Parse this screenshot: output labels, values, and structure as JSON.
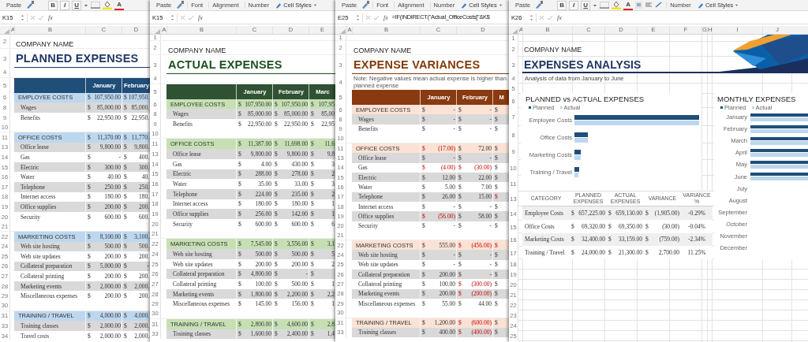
{
  "sheets": [
    {
      "kind": "table",
      "ribbon": [
        {
          "kind": "paste",
          "label": "Paste"
        },
        {
          "kind": "format",
          "labels": [
            "B",
            "I",
            "U"
          ],
          "font_color": "A"
        }
      ],
      "name_box": "K15",
      "fx": "fx",
      "columns": [
        "A",
        "B",
        "C",
        "D"
      ],
      "rows": [
        {
          "n": "2",
          "kind": "company",
          "text": "COMPANY NAME"
        },
        {
          "n": "3",
          "kind": "title",
          "text": "PLANNED EXPENSES"
        },
        {
          "n": "4",
          "kind": "blank"
        },
        {
          "n": "5",
          "kind": "months",
          "months": [
            "January",
            "February"
          ]
        },
        {
          "n": "6",
          "kind": "section",
          "label": "EMPLOYEE COSTS",
          "cells": [
            [
              "$",
              "107,950.00"
            ],
            [
              "$",
              "107,950."
            ]
          ]
        },
        {
          "n": "8",
          "kind": "item",
          "shaded": true,
          "label": "Wages",
          "cells": [
            [
              "$",
              "85,000.00"
            ],
            [
              "$",
              "85,000."
            ]
          ]
        },
        {
          "n": "9",
          "kind": "item",
          "shaded": false,
          "label": "Benefits",
          "cells": [
            [
              "$",
              "22,950.00"
            ],
            [
              "$",
              "22,950."
            ]
          ]
        },
        {
          "n": "10",
          "kind": "blank"
        },
        {
          "n": "11",
          "kind": "section",
          "label": "OFFICE COSTS",
          "cells": [
            [
              "$",
              "11,370.00"
            ],
            [
              "$",
              "11,770."
            ]
          ]
        },
        {
          "n": "13",
          "kind": "item",
          "shaded": true,
          "label": "Office lease",
          "cells": [
            [
              "$",
              "9,800.00"
            ],
            [
              "$",
              "9,800."
            ]
          ]
        },
        {
          "n": "14",
          "kind": "item",
          "shaded": false,
          "label": "Gas",
          "cells": [
            [
              "$",
              "-"
            ],
            [
              "$",
              "400."
            ]
          ]
        },
        {
          "n": "15",
          "kind": "item",
          "shaded": true,
          "label": "Electric",
          "cells": [
            [
              "$",
              "300.00"
            ],
            [
              "$",
              "300."
            ]
          ]
        },
        {
          "n": "16",
          "kind": "item",
          "shaded": false,
          "label": "Water",
          "cells": [
            [
              "$",
              "40.00"
            ],
            [
              "$",
              "40."
            ]
          ]
        },
        {
          "n": "17",
          "kind": "item",
          "shaded": true,
          "label": "Telephone",
          "cells": [
            [
              "$",
              "250.00"
            ],
            [
              "$",
              "250."
            ]
          ]
        },
        {
          "n": "18",
          "kind": "item",
          "shaded": false,
          "label": "Internet access",
          "cells": [
            [
              "$",
              "180.00"
            ],
            [
              "$",
              "180."
            ]
          ]
        },
        {
          "n": "19",
          "kind": "item",
          "shaded": true,
          "label": "Office supplies",
          "cells": [
            [
              "$",
              "200.00"
            ],
            [
              "$",
              "200."
            ]
          ]
        },
        {
          "n": "20",
          "kind": "item",
          "shaded": false,
          "label": "Security",
          "cells": [
            [
              "$",
              "600.00"
            ],
            [
              "$",
              "600."
            ]
          ]
        },
        {
          "n": "21",
          "kind": "blank"
        },
        {
          "n": "22",
          "kind": "section",
          "label": "MARKETING COSTS",
          "cells": [
            [
              "$",
              "8,100.00"
            ],
            [
              "$",
              "3,100."
            ]
          ]
        },
        {
          "n": "24",
          "kind": "item",
          "shaded": true,
          "label": "Web site hosting",
          "cells": [
            [
              "$",
              "500.00"
            ],
            [
              "$",
              "500."
            ]
          ]
        },
        {
          "n": "25",
          "kind": "item",
          "shaded": false,
          "label": "Web site updates",
          "cells": [
            [
              "$",
              "200.00"
            ],
            [
              "$",
              "200."
            ]
          ]
        },
        {
          "n": "26",
          "kind": "item",
          "shaded": true,
          "label": "Collateral preparation",
          "cells": [
            [
              "$",
              "5,000.00"
            ],
            [
              "$",
              "-"
            ]
          ]
        },
        {
          "n": "27",
          "kind": "item",
          "shaded": false,
          "label": "Collateral printing",
          "cells": [
            [
              "$",
              "200.00"
            ],
            [
              "$",
              "200."
            ]
          ]
        },
        {
          "n": "28",
          "kind": "item",
          "shaded": true,
          "label": "Marketing events",
          "cells": [
            [
              "$",
              "2,000.00"
            ],
            [
              "$",
              "2,000."
            ]
          ]
        },
        {
          "n": "29",
          "kind": "item",
          "shaded": false,
          "label": "Miscellaneous expenses",
          "cells": [
            [
              "$",
              "200.00"
            ],
            [
              "$",
              "200."
            ]
          ]
        },
        {
          "n": "30",
          "kind": "blank"
        },
        {
          "n": "31",
          "kind": "section",
          "label": "TRAINING / TRAVEL",
          "cells": [
            [
              "$",
              "4,000.00"
            ],
            [
              "$",
              "4,000."
            ]
          ]
        },
        {
          "n": "33",
          "kind": "item",
          "shaded": true,
          "label": "Training classes",
          "cells": [
            [
              "$",
              "2,000.00"
            ],
            [
              "$",
              "2,000."
            ]
          ]
        },
        {
          "n": "34",
          "kind": "item",
          "shaded": false,
          "label": "Travel costs",
          "cells": [
            [
              "$",
              "2,000.00"
            ],
            [
              "$",
              "2,000."
            ]
          ]
        }
      ]
    },
    {
      "kind": "table",
      "ribbon": [
        {
          "kind": "paste",
          "label": "Paste"
        },
        {
          "kind": "group",
          "label": "Font"
        },
        {
          "kind": "group",
          "label": "Alignment"
        },
        {
          "kind": "group",
          "label": "Number"
        },
        {
          "kind": "styles",
          "label": "Cell Styles"
        }
      ],
      "name_box": "K15",
      "fx": "fx",
      "columns": [
        "A",
        "B",
        "C",
        "D",
        "E"
      ],
      "rows": [
        {
          "n": "1",
          "kind": "blank"
        },
        {
          "n": "2",
          "kind": "company",
          "text": "COMPANY NAME"
        },
        {
          "n": "3",
          "kind": "title",
          "text": "ACTUAL EXPENSES"
        },
        {
          "n": "4",
          "kind": "blank"
        },
        {
          "n": "5",
          "kind": "months",
          "months": [
            "January",
            "February",
            "Marc"
          ]
        },
        {
          "n": "6",
          "kind": "section",
          "label": "EMPLOYEE COSTS",
          "cells": [
            [
              "$",
              "107,950.00"
            ],
            [
              "$",
              "107,950.00"
            ],
            [
              "$",
              "107,95"
            ]
          ]
        },
        {
          "n": "8",
          "kind": "item",
          "shaded": true,
          "label": "Wages",
          "cells": [
            [
              "$",
              "85,000.00"
            ],
            [
              "$",
              "85,000.00"
            ],
            [
              "$",
              "85,00"
            ]
          ]
        },
        {
          "n": "9",
          "kind": "item",
          "shaded": false,
          "label": "Benefits",
          "cells": [
            [
              "$",
              "22,950.00"
            ],
            [
              "$",
              "22,950.00"
            ],
            [
              "$",
              "22,95"
            ]
          ]
        },
        {
          "n": "10",
          "kind": "blank"
        },
        {
          "n": "11",
          "kind": "section",
          "label": "OFFICE COSTS",
          "cells": [
            [
              "$",
              "11,387.00"
            ],
            [
              "$",
              "11,698.00"
            ],
            [
              "$",
              "11,6"
            ]
          ]
        },
        {
          "n": "13",
          "kind": "item",
          "shaded": true,
          "label": "Office lease",
          "cells": [
            [
              "$",
              "9,800.00"
            ],
            [
              "$",
              "9,800.00"
            ],
            [
              "$",
              "9,8"
            ]
          ]
        },
        {
          "n": "14",
          "kind": "item",
          "shaded": false,
          "label": "Gas",
          "cells": [
            [
              "$",
              "4.00"
            ],
            [
              "$",
              "430.00"
            ],
            [
              "$",
              "3"
            ]
          ]
        },
        {
          "n": "15",
          "kind": "item",
          "shaded": true,
          "label": "Electric",
          "cells": [
            [
              "$",
              "288.00"
            ],
            [
              "$",
              "278.00"
            ],
            [
              "$",
              "2"
            ]
          ]
        },
        {
          "n": "16",
          "kind": "item",
          "shaded": false,
          "label": "Water",
          "cells": [
            [
              "$",
              "35.00"
            ],
            [
              "$",
              "33.00"
            ],
            [
              "$",
              "3"
            ]
          ]
        },
        {
          "n": "17",
          "kind": "item",
          "shaded": true,
          "label": "Telephone",
          "cells": [
            [
              "$",
              "224.00"
            ],
            [
              "$",
              "235.00"
            ],
            [
              "$",
              "2"
            ]
          ]
        },
        {
          "n": "18",
          "kind": "item",
          "shaded": false,
          "label": "Internet access",
          "cells": [
            [
              "$",
              "180.00"
            ],
            [
              "$",
              "180.00"
            ],
            [
              "$",
              "1"
            ]
          ]
        },
        {
          "n": "19",
          "kind": "item",
          "shaded": true,
          "label": "Office supplies",
          "cells": [
            [
              "$",
              "256.00"
            ],
            [
              "$",
              "142.00"
            ],
            [
              "$",
              "1"
            ]
          ]
        },
        {
          "n": "20",
          "kind": "item",
          "shaded": false,
          "label": "Security",
          "cells": [
            [
              "$",
              "600.00"
            ],
            [
              "$",
              "600.00"
            ],
            [
              "$",
              "6"
            ]
          ]
        },
        {
          "n": "21",
          "kind": "blank"
        },
        {
          "n": "22",
          "kind": "section",
          "label": "MARKETING COSTS",
          "cells": [
            [
              "$",
              "7,545.00"
            ],
            [
              "$",
              "3,556.00"
            ],
            [
              "$",
              "3,1"
            ]
          ]
        },
        {
          "n": "24",
          "kind": "item",
          "shaded": true,
          "label": "Web site hosting",
          "cells": [
            [
              "$",
              "500.00"
            ],
            [
              "$",
              "500.00"
            ],
            [
              "$",
              "5"
            ]
          ]
        },
        {
          "n": "25",
          "kind": "item",
          "shaded": false,
          "label": "Web site updates",
          "cells": [
            [
              "$",
              "200.00"
            ],
            [
              "$",
              "200.00"
            ],
            [
              "$",
              "2"
            ]
          ]
        },
        {
          "n": "26",
          "kind": "item",
          "shaded": true,
          "label": "Collateral preparation",
          "cells": [
            [
              "$",
              "4,800.00"
            ],
            [
              "$",
              "-"
            ],
            [
              "$"
            ]
          ]
        },
        {
          "n": "27",
          "kind": "item",
          "shaded": false,
          "label": "Collateral printing",
          "cells": [
            [
              "$",
              "100.00"
            ],
            [
              "$",
              "500.00"
            ],
            [
              "$",
              "1"
            ]
          ]
        },
        {
          "n": "28",
          "kind": "item",
          "shaded": true,
          "label": "Marketing events",
          "cells": [
            [
              "$",
              "1,800.00"
            ],
            [
              "$",
              "2,200.00"
            ],
            [
              "$",
              "2,2"
            ]
          ]
        },
        {
          "n": "29",
          "kind": "item",
          "shaded": false,
          "label": "Miscellaneous expenses",
          "cells": [
            [
              "$",
              "145.00"
            ],
            [
              "$",
              "156.00"
            ],
            [
              "$",
              "1"
            ]
          ]
        },
        {
          "n": "30",
          "kind": "blank"
        },
        {
          "n": "31",
          "kind": "section",
          "label": "TRAINING / TRAVEL",
          "cells": [
            [
              "$",
              "2,800.00"
            ],
            [
              "$",
              "4,600.00"
            ],
            [
              "$",
              "2,8"
            ]
          ]
        },
        {
          "n": "33",
          "kind": "item",
          "shaded": true,
          "label": "Training classes",
          "cells": [
            [
              "$",
              "1,600.00"
            ],
            [
              "$",
              "2,400.00"
            ],
            [
              "$",
              "1,4"
            ]
          ]
        }
      ]
    },
    {
      "kind": "table",
      "ribbon": [
        {
          "kind": "paste",
          "label": "Paste"
        },
        {
          "kind": "group",
          "label": "Font"
        },
        {
          "kind": "group",
          "label": "Alignment"
        },
        {
          "kind": "group",
          "label": "Number"
        },
        {
          "kind": "styles",
          "label": "Cell Styles"
        }
      ],
      "name_box": "E25",
      "fx": "fx",
      "formula": "=IF(INDIRECT(\"Actual_OfficeCosts[\"&K$",
      "columns": [
        "A",
        "B",
        "C",
        "D"
      ],
      "rows": [
        {
          "n": "1",
          "kind": "blank"
        },
        {
          "n": "2",
          "kind": "company",
          "text": "COMPANY NAME"
        },
        {
          "n": "3",
          "kind": "title",
          "text": "EXPENSE VARIANCES"
        },
        {
          "n": "4",
          "kind": "note",
          "text": "Note: Negative values mean actual expense is higher than planned expense"
        },
        {
          "n": "5",
          "kind": "months",
          "months": [
            "January",
            "February",
            "M"
          ]
        },
        {
          "n": "6",
          "kind": "section",
          "label": "EMPLOYEE COSTS",
          "cells": [
            [
              "$",
              "-"
            ],
            [
              "$",
              "-"
            ],
            [
              "$"
            ]
          ],
          "negative": [
            false,
            false,
            false
          ]
        },
        {
          "n": "8",
          "kind": "item",
          "shaded": true,
          "label": "Wages",
          "cells": [
            [
              "$",
              "-"
            ],
            [
              "$",
              "-"
            ],
            [
              "$"
            ]
          ],
          "negative": [
            false,
            false,
            false
          ]
        },
        {
          "n": "9",
          "kind": "item",
          "shaded": false,
          "label": "Benefits",
          "cells": [
            [
              "$",
              "-"
            ],
            [
              "$",
              "-"
            ],
            [
              "$"
            ]
          ],
          "negative": [
            false,
            false,
            false
          ]
        },
        {
          "n": "10",
          "kind": "blank"
        },
        {
          "n": "11",
          "kind": "section",
          "label": "OFFICE COSTS",
          "cells": [
            [
              "$",
              "(17.00)"
            ],
            [
              "$",
              "72.00"
            ],
            [
              "$"
            ]
          ],
          "negative": [
            true,
            false,
            false
          ]
        },
        {
          "n": "13",
          "kind": "item",
          "shaded": true,
          "label": "Office lease",
          "cells": [
            [
              "$",
              "-"
            ],
            [
              "$",
              "-"
            ],
            [
              "$"
            ]
          ],
          "negative": [
            false,
            false,
            false
          ]
        },
        {
          "n": "14",
          "kind": "item",
          "shaded": false,
          "label": "Gas",
          "cells": [
            [
              "$",
              "(4.00)"
            ],
            [
              "$",
              "(30.00)"
            ],
            [
              "$"
            ]
          ],
          "negative": [
            true,
            true,
            false
          ]
        },
        {
          "n": "15",
          "kind": "item",
          "shaded": true,
          "label": "Electric",
          "cells": [
            [
              "$",
              "12.00"
            ],
            [
              "$",
              "22.00"
            ],
            [
              "$"
            ]
          ],
          "negative": [
            false,
            false,
            false
          ]
        },
        {
          "n": "16",
          "kind": "item",
          "shaded": false,
          "label": "Water",
          "cells": [
            [
              "$",
              "5.00"
            ],
            [
              "$",
              "7.00"
            ],
            [
              "$"
            ]
          ],
          "negative": [
            false,
            false,
            false
          ]
        },
        {
          "n": "17",
          "kind": "item",
          "shaded": true,
          "label": "Telephone",
          "cells": [
            [
              "$",
              "26.00"
            ],
            [
              "$",
              "15.00"
            ],
            [
              "$"
            ]
          ],
          "negative": [
            false,
            false,
            true
          ]
        },
        {
          "n": "18",
          "kind": "item",
          "shaded": false,
          "label": "Internet access",
          "cells": [
            [
              "$",
              "-"
            ],
            [
              "$",
              "-"
            ],
            [
              "$"
            ]
          ],
          "negative": [
            false,
            false,
            false
          ]
        },
        {
          "n": "19",
          "kind": "item",
          "shaded": true,
          "label": "Office supplies",
          "cells": [
            [
              "$",
              "(56.00)"
            ],
            [
              "$",
              "58.00"
            ],
            [
              "$"
            ]
          ],
          "negative": [
            true,
            false,
            false
          ]
        },
        {
          "n": "20",
          "kind": "item",
          "shaded": false,
          "label": "Security",
          "cells": [
            [
              "$",
              "-"
            ],
            [
              "$",
              "-"
            ],
            [
              "$"
            ]
          ],
          "negative": [
            false,
            false,
            false
          ]
        },
        {
          "n": "21",
          "kind": "blank"
        },
        {
          "n": "22",
          "kind": "section",
          "label": "MARKETING COSTS",
          "cells": [
            [
              "$",
              "555.00"
            ],
            [
              "$",
              "(456.00)"
            ],
            [
              "$"
            ]
          ],
          "negative": [
            false,
            true,
            true
          ]
        },
        {
          "n": "24",
          "kind": "item",
          "shaded": true,
          "label": "Web site hosting",
          "cells": [
            [
              "$",
              "-"
            ],
            [
              "$",
              "-"
            ],
            [
              "$"
            ]
          ],
          "negative": [
            false,
            false,
            false
          ]
        },
        {
          "n": "25",
          "kind": "item",
          "shaded": false,
          "label": "Web site updates",
          "cells": [
            [
              "$",
              "-"
            ],
            [
              "$",
              "-"
            ],
            [
              "$"
            ]
          ],
          "negative": [
            false,
            false,
            false
          ]
        },
        {
          "n": "26",
          "kind": "item",
          "shaded": true,
          "label": "Collateral preparation",
          "cells": [
            [
              "$",
              "200.00"
            ],
            [
              "$",
              "-"
            ],
            [
              "$"
            ]
          ],
          "negative": [
            false,
            false,
            false
          ]
        },
        {
          "n": "27",
          "kind": "item",
          "shaded": false,
          "label": "Collateral printing",
          "cells": [
            [
              "$",
              "100.00"
            ],
            [
              "$",
              "(300.00)"
            ],
            [
              "$"
            ]
          ],
          "negative": [
            false,
            true,
            false
          ]
        },
        {
          "n": "28",
          "kind": "item",
          "shaded": true,
          "label": "Marketing events",
          "cells": [
            [
              "$",
              "200.00"
            ],
            [
              "$",
              "(200.00)"
            ],
            [
              "$"
            ]
          ],
          "negative": [
            false,
            true,
            false
          ]
        },
        {
          "n": "29",
          "kind": "item",
          "shaded": false,
          "label": "Miscellaneous expenses",
          "cells": [
            [
              "$",
              "55.00"
            ],
            [
              "$",
              "44.00"
            ],
            [
              "$"
            ]
          ],
          "negative": [
            false,
            false,
            false
          ]
        },
        {
          "n": "30",
          "kind": "blank"
        },
        {
          "n": "31",
          "kind": "section",
          "label": "TRAINING / TRAVEL",
          "cells": [
            [
              "$",
              "1,200.00"
            ],
            [
              "$",
              "(600.00)"
            ],
            [
              "$"
            ]
          ],
          "negative": [
            false,
            true,
            false
          ]
        },
        {
          "n": "33",
          "kind": "item",
          "shaded": true,
          "label": "Training classes",
          "cells": [
            [
              "$",
              "400.00"
            ],
            [
              "$",
              "(400.00)"
            ],
            [
              "$"
            ]
          ],
          "negative": [
            false,
            true,
            false
          ]
        }
      ]
    },
    {
      "kind": "analysis",
      "ribbon": [
        {
          "kind": "paste",
          "label": "Paste"
        },
        {
          "kind": "format",
          "labels": [
            "B",
            "I",
            "U"
          ],
          "font_color": "A"
        },
        {
          "kind": "align"
        },
        {
          "kind": "group",
          "label": "Number"
        },
        {
          "kind": "styles",
          "label": "Cell Styles"
        }
      ],
      "name_box": "K26",
      "fx": "fx",
      "columns": [
        "A",
        "B",
        "C",
        "D",
        "E",
        "F",
        "G",
        "H",
        "I",
        "J"
      ],
      "row_numbers": [
        "1",
        "2",
        "3",
        "4",
        "5",
        "6",
        "7",
        "8",
        "9",
        "10",
        "11",
        "13",
        "14",
        "15",
        "16",
        "17",
        "18",
        "19",
        "20",
        "21",
        "22",
        "23",
        "24",
        "25"
      ],
      "company": "COMPANY NAME",
      "title": "EXPENSES ANALYSIS",
      "subtitle": "Analysis of data from January to June",
      "comparison_chart": {
        "title": "PLANNED vs ACTUAL EXPENSES",
        "legend": [
          {
            "label": "Planned",
            "color": "#1f4e79"
          },
          {
            "label": "Actual",
            "color": "#bdd7ee"
          }
        ],
        "categories": [
          "Employee Costs",
          "Office Costs",
          "Marketing Costs",
          "Training / Travel"
        ]
      },
      "table": {
        "columns": [
          "CATEGORY",
          "PLANNED EXPENSES",
          "ACTUAL EXPENSES",
          "VARIANCE",
          "VARIANCE %"
        ],
        "rows": [
          {
            "shaded": true,
            "cells": [
              [
                "Employee Costs"
              ],
              [
                "$",
                "657,225.00"
              ],
              [
                "$",
                "659,130.00"
              ],
              [
                "$",
                "(1,905.00)"
              ],
              [
                "-0.29%"
              ]
            ]
          },
          {
            "shaded": false,
            "cells": [
              [
                "Office Costs"
              ],
              [
                "$",
                "69,320.00"
              ],
              [
                "$",
                "69,350.00"
              ],
              [
                "$",
                "(30.00)"
              ],
              [
                "-0.04%"
              ]
            ]
          },
          {
            "shaded": true,
            "cells": [
              [
                "Marketing Costs"
              ],
              [
                "$",
                "32,400.00"
              ],
              [
                "$",
                "33,159.00"
              ],
              [
                "$",
                "(759.00)"
              ],
              [
                "-2.34%"
              ]
            ]
          },
          {
            "shaded": false,
            "cells": [
              [
                "Training / Travel"
              ],
              [
                "$",
                "24,000.00"
              ],
              [
                "$",
                "21,300.00"
              ],
              [
                "$",
                "2,700.00"
              ],
              [
                "11.25%"
              ]
            ]
          }
        ]
      },
      "monthly_chart": {
        "title": "MONTHLY EXPENSES",
        "legend": [
          {
            "label": "Planned",
            "color": "#1f4e79"
          },
          {
            "label": "Actual",
            "color": "#bdd7ee"
          }
        ],
        "categories": [
          {
            "label": "January",
            "bars": true
          },
          {
            "label": "February",
            "bars": true
          },
          {
            "label": "March",
            "bars": true
          },
          {
            "label": "April",
            "bars": true
          },
          {
            "label": "May",
            "bars": true
          },
          {
            "label": "June",
            "bars": true
          },
          {
            "label": "July",
            "bars": false
          },
          {
            "label": "August",
            "bars": false
          },
          {
            "label": "September",
            "bars": false
          },
          {
            "label": "October",
            "bars": false
          },
          {
            "label": "November",
            "bars": false
          },
          {
            "label": "December",
            "bars": false
          }
        ]
      }
    }
  ]
}
